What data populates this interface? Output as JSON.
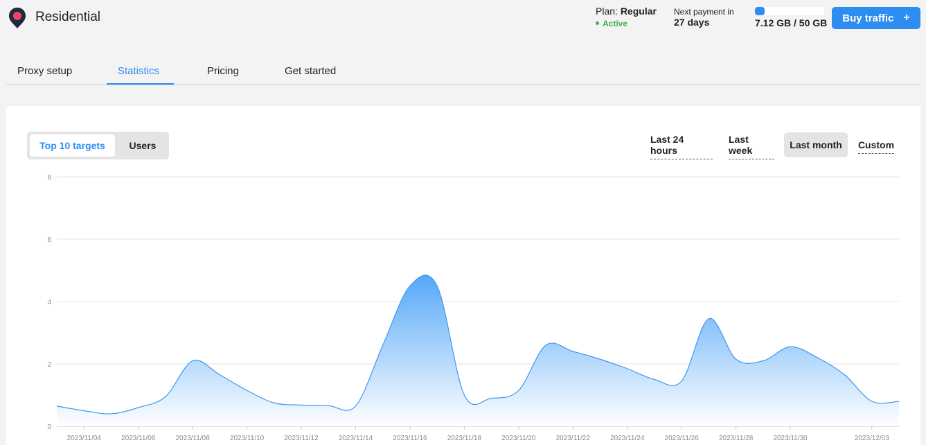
{
  "header": {
    "app_title": "Residential",
    "plan_label": "Plan:",
    "plan_name": "Regular",
    "plan_status": "Active",
    "next_payment_label": "Next payment in",
    "next_payment_days": "27 days",
    "usage_text": "7.12 GB / 50 GB",
    "usage_fraction": 0.1424,
    "buy_label": "Buy traffic",
    "buy_icon": "+"
  },
  "tabs": [
    {
      "label": "Proxy setup"
    },
    {
      "label": "Statistics"
    },
    {
      "label": "Pricing"
    },
    {
      "label": "Get started"
    }
  ],
  "toggle": {
    "targets_label": "Top 10 targets",
    "users_label": "Users"
  },
  "ranges": [
    {
      "label": "Last 24 hours"
    },
    {
      "label": "Last week"
    },
    {
      "label": "Last month"
    },
    {
      "label": "Custom"
    }
  ],
  "colors": {
    "accent": "#2d8df0",
    "active_status": "#3fb24a",
    "area_top": "#56a8f8",
    "area_bottom": "#ffffff",
    "line": "#3f97ee"
  },
  "chart_data": {
    "type": "area",
    "x": [
      "2023/11/03",
      "2023/11/04",
      "2023/11/05",
      "2023/11/06",
      "2023/11/07",
      "2023/11/08",
      "2023/11/09",
      "2023/11/10",
      "2023/11/11",
      "2023/11/12",
      "2023/11/13",
      "2023/11/14",
      "2023/11/15",
      "2023/11/16",
      "2023/11/17",
      "2023/11/18",
      "2023/11/19",
      "2023/11/20",
      "2023/11/21",
      "2023/11/22",
      "2023/11/23",
      "2023/11/24",
      "2023/11/25",
      "2023/11/26",
      "2023/11/27",
      "2023/11/28",
      "2023/11/29",
      "2023/11/30",
      "2023/12/01",
      "2023/12/02",
      "2023/12/03",
      "2023/12/04"
    ],
    "values": [
      0.65,
      0.5,
      0.4,
      0.6,
      0.95,
      2.1,
      1.65,
      1.15,
      0.75,
      0.68,
      0.66,
      0.65,
      2.6,
      4.5,
      4.5,
      1.0,
      0.9,
      1.15,
      2.6,
      2.4,
      2.15,
      1.85,
      1.5,
      1.45,
      3.45,
      2.15,
      2.1,
      2.55,
      2.2,
      1.65,
      0.8,
      0.8
    ],
    "x_tick_labels": [
      "2023/11/04",
      "2023/11/06",
      "2023/11/08",
      "2023/11/10",
      "2023/11/12",
      "2023/11/14",
      "2023/11/16",
      "2023/11/18",
      "2023/11/20",
      "2023/11/22",
      "2023/11/24",
      "2023/11/26",
      "2023/11/28",
      "2023/11/30",
      "2023/12/03"
    ],
    "y_ticks": [
      "0",
      "2",
      "4",
      "6",
      "8"
    ],
    "ylim": [
      0,
      8
    ],
    "grid": true,
    "legend": "none",
    "title": "",
    "xlabel": "",
    "ylabel": ""
  }
}
